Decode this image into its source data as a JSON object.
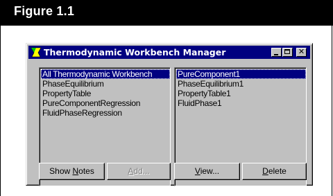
{
  "figure": {
    "label": "Figure 1.1"
  },
  "window": {
    "title": "Thermodynamic Workbench Manager",
    "controls": {
      "minimize": "_",
      "maximize": "□",
      "close": "✕"
    }
  },
  "left_list": {
    "items": [
      "All Thermodynamic Workbench",
      "PhaseEquilibrium",
      "PropertyTable",
      "PureComponentRegression",
      "FluidPhaseRegression"
    ],
    "selected_index": 0
  },
  "right_list": {
    "items": [
      "PureComponent1",
      "PhaseEquilibrium1",
      "PropertyTable1",
      "FluidPhase1"
    ],
    "selected_index": 0
  },
  "buttons": {
    "show_notes": {
      "prefix": "Show ",
      "mnemonic": "N",
      "suffix": "otes"
    },
    "add": {
      "prefix": "",
      "mnemonic": "A",
      "suffix": "dd...",
      "enabled": false
    },
    "view": {
      "prefix": "",
      "mnemonic": "V",
      "suffix": "iew...",
      "enabled": true
    },
    "delete": {
      "prefix": "",
      "mnemonic": "D",
      "suffix": "elete",
      "enabled": true
    }
  },
  "colors": {
    "title_bar": "#000080",
    "selection": "#000080",
    "face": "#c0c0c0",
    "figure_header": "#000000"
  }
}
